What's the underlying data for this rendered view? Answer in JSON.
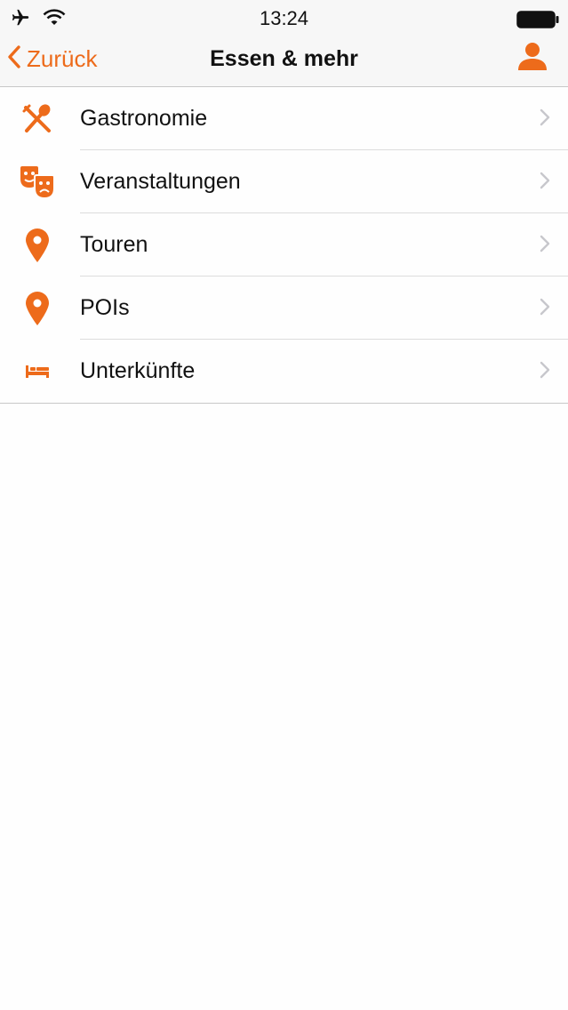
{
  "status_bar": {
    "time": "13:24",
    "icons": [
      "airplane-icon",
      "wifi-icon",
      "battery-icon"
    ]
  },
  "nav": {
    "back_label": "Zurück",
    "title": "Essen & mehr",
    "profile_icon": "person-icon"
  },
  "colors": {
    "accent": "#ed6b1b",
    "text": "#111111",
    "chevron": "#c7c7cc",
    "separator": "#dcdcdc"
  },
  "list": {
    "items": [
      {
        "label": "Gastronomie",
        "icon": "cutlery-icon"
      },
      {
        "label": "Veranstaltungen",
        "icon": "theater-masks-icon"
      },
      {
        "label": "Touren",
        "icon": "map-pin-icon"
      },
      {
        "label": "POIs",
        "icon": "map-pin-icon"
      },
      {
        "label": "Unterkünfte",
        "icon": "bed-icon"
      }
    ]
  }
}
